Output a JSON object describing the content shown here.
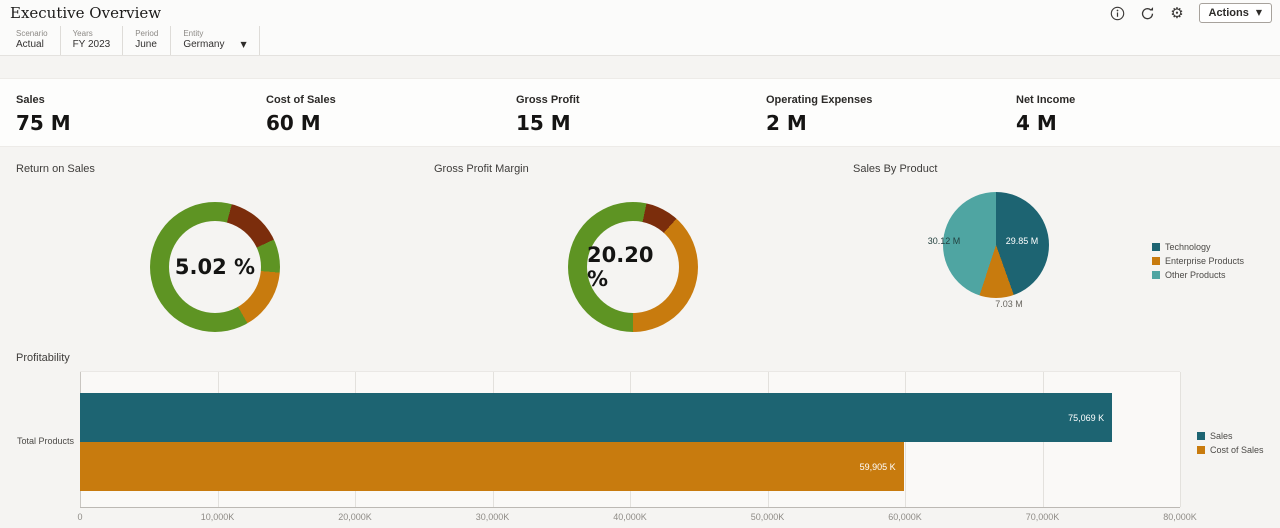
{
  "header": {
    "title": "Executive Overview",
    "actions_label": "Actions"
  },
  "pov": {
    "items": [
      {
        "label": "Scenario",
        "value": "Actual"
      },
      {
        "label": "Years",
        "value": "FY 2023"
      },
      {
        "label": "Period",
        "value": "June"
      },
      {
        "label": "Entity",
        "value": "Germany"
      }
    ]
  },
  "kpis": [
    {
      "label": "Sales",
      "value": "75 M"
    },
    {
      "label": "Cost of Sales",
      "value": "60 M"
    },
    {
      "label": "Gross Profit",
      "value": "15 M"
    },
    {
      "label": "Operating Expenses",
      "value": "2 M"
    },
    {
      "label": "Net Income",
      "value": "4 M"
    }
  ],
  "chart_data": [
    {
      "type": "gauge",
      "title": "Return on Sales",
      "value": 5.02,
      "value_label": "5.02 %",
      "unit": "%"
    },
    {
      "type": "gauge",
      "title": "Gross Profit Margin",
      "value": 20.2,
      "value_label": "20.20 %",
      "unit": "%"
    },
    {
      "type": "pie",
      "title": "Sales By Product",
      "labels": [
        "Technology",
        "Enterprise Products",
        "Other Products"
      ],
      "values": [
        29.85,
        7.03,
        30.12
      ],
      "value_labels": [
        "29.85 M",
        "7.03 M",
        "30.12 M"
      ],
      "colors": [
        "#1d6472",
        "#c87b0e",
        "#4fa5a2"
      ],
      "legend_position": "right"
    },
    {
      "type": "bar",
      "title": "Profitability",
      "orientation": "horizontal",
      "categories": [
        "Total Products"
      ],
      "series": [
        {
          "name": "Sales",
          "values": [
            75069
          ],
          "value_label": "75,069 K",
          "color": "#1d6472"
        },
        {
          "name": "Cost of Sales",
          "values": [
            59905
          ],
          "value_label": "59,905 K",
          "color": "#c87b0e"
        }
      ],
      "x_ticks": [
        "0",
        "10,000K",
        "20,000K",
        "30,000K",
        "40,000K",
        "50,000K",
        "60,000K",
        "70,000K",
        "80,000K"
      ],
      "xlim": [
        0,
        80000
      ],
      "grid": true,
      "legend_position": "right"
    }
  ],
  "colors": {
    "green": "#5e9423",
    "maroon": "#7b2d0c",
    "orange": "#c87b0e",
    "teal_dark": "#1d6472",
    "teal_light": "#4fa5a2"
  }
}
